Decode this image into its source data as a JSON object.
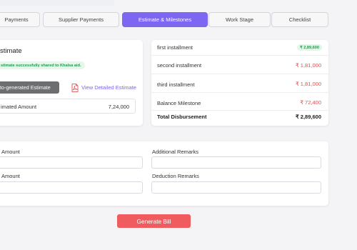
{
  "tabs": [
    {
      "label": "Payments"
    },
    {
      "label": "Supplier Payments"
    },
    {
      "label": "Estimate & Milestones"
    },
    {
      "label": "Work Stage"
    },
    {
      "label": "Checklist"
    }
  ],
  "estimate": {
    "title": "stimate",
    "success_message": "stimate successfully shared to Khalsa aid.",
    "auto_button": "to-generated Estimate",
    "view_link": "View Detailed Estimate",
    "amount_label": "imated Amount",
    "amount_value": "7,24,000"
  },
  "installments": [
    {
      "label": "first installment",
      "value": "₹ 2,89,600",
      "status": "paid"
    },
    {
      "label": "second installment",
      "value": "₹ 1,81,000",
      "status": "pending"
    },
    {
      "label": "third installment",
      "value": "₹ 1,81,000",
      "status": "pending"
    },
    {
      "label": "Balance Milestone",
      "value": "₹ 72,400",
      "status": "pending"
    }
  ],
  "total": {
    "label": "Total Disbursement",
    "value": "₹ 2,89,600"
  },
  "form": {
    "left_label_1": "Amount",
    "right_label_1": "Additional Remarks",
    "left_label_2": "Amount",
    "right_label_2": "Deduction Remarks"
  },
  "generate_button": "Generate Bill",
  "colors": {
    "accent": "#7c66f2",
    "danger": "#ef5b5e",
    "success": "#1e9d4c"
  }
}
